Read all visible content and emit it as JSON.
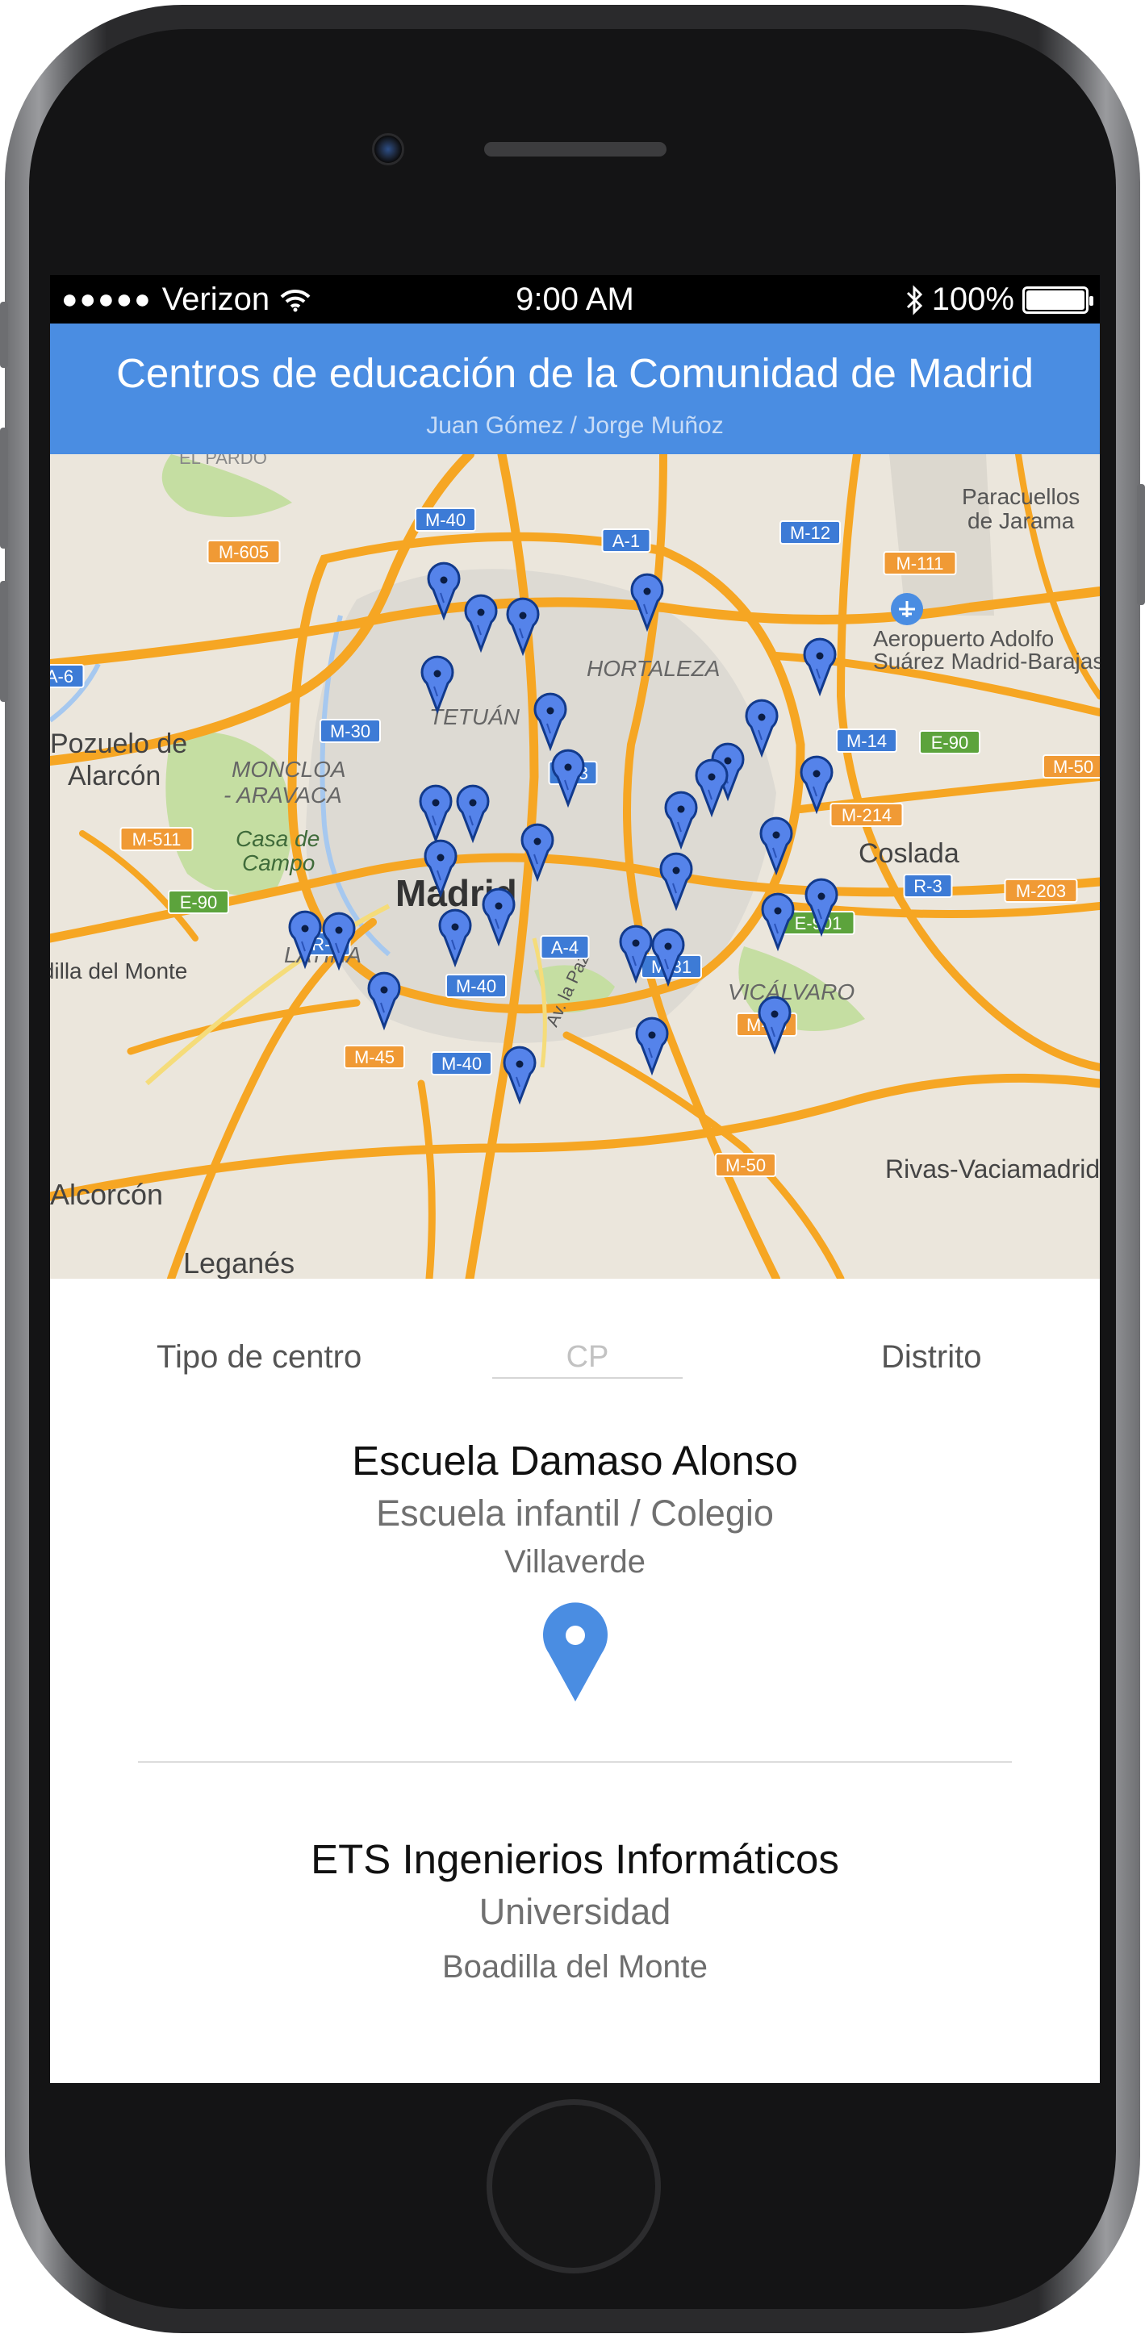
{
  "status_bar": {
    "signal_dots": "●●●●●",
    "carrier": "Verizon",
    "time": "9:00 AM",
    "battery": "100%",
    "battery_level": 1.0
  },
  "header": {
    "title": "Centros de educación de la Comunidad de Madrid",
    "subtitle": "Juan Gómez / Jorge Muñoz"
  },
  "map": {
    "city_label": "Madrid",
    "place_labels": [
      "EL PARDO",
      "Paracuellos",
      "de Jarama",
      "Aeropuerto Adolfo",
      "Suárez Madrid-Barajas",
      "HORTALEZA",
      "TETUÁN",
      "Pozuelo de",
      "Alarcón",
      "MONCLOA",
      "- ARAVACA",
      "Casa de",
      "Campo",
      "Coslada",
      "LATINA",
      "VICÁLVARO",
      "Rivas-Vaciamadrid",
      "Leganés",
      "Alcorcón",
      "Boadilla del Monte",
      "Av. la Paz"
    ],
    "road_labels": [
      "M-40",
      "M-605",
      "A-6",
      "M-30",
      "M-12",
      "A-1",
      "M-111",
      "M-14",
      "E-90",
      "M-50",
      "M-214",
      "M-511",
      "R-3",
      "M-203",
      "E-90",
      "E-901",
      "R-5",
      "A-4",
      "M-31",
      "M-45",
      "M-45",
      "M-50",
      "M-40",
      "M-40",
      "M-3"
    ],
    "marker_count": 31,
    "colors": {
      "water": "#a6c8ef",
      "park": "#c5dea2",
      "land": "#ebe6dc",
      "urban": "#dddad3",
      "highway": "#f6a623",
      "marker": "#5583ea"
    }
  },
  "filters": {
    "tipo_label": "Tipo de centro",
    "cp_placeholder": "CP",
    "distrito_label": "Distrito"
  },
  "results": [
    {
      "name": "Escuela Damaso Alonso",
      "type": "Escuela infantil / Colegio",
      "location": "Villaverde",
      "pin_icon": "location-pin-icon",
      "pin_color": "#4a8de2"
    },
    {
      "name": "ETS Ingenierios Informáticos",
      "type": "Universidad",
      "location": "Boadilla del Monte"
    }
  ]
}
